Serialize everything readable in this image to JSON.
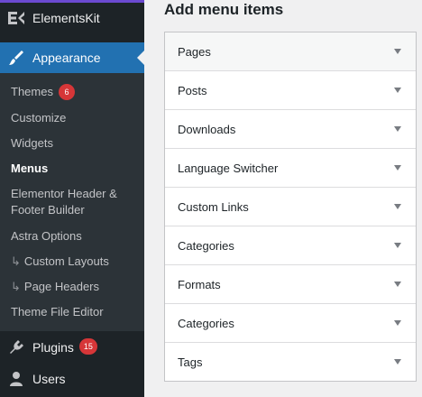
{
  "sidebar": {
    "elementskit": {
      "label": "ElementsKit"
    },
    "appearance": {
      "label": "Appearance"
    },
    "submenu": [
      {
        "label": "Themes",
        "badge": "6"
      },
      {
        "label": "Customize"
      },
      {
        "label": "Widgets"
      },
      {
        "label": "Menus"
      },
      {
        "label_line1": "Elementor Header &",
        "label_line2": "Footer Builder"
      },
      {
        "label": "Astra Options"
      },
      {
        "label": "Custom Layouts",
        "prefix": "↳"
      },
      {
        "label": "Page Headers",
        "prefix": "↳"
      },
      {
        "label": "Theme File Editor"
      }
    ],
    "plugins": {
      "label": "Plugins",
      "badge": "15"
    },
    "users": {
      "label": "Users"
    }
  },
  "main": {
    "title": "Add menu items",
    "accordion": [
      {
        "label": "Pages"
      },
      {
        "label": "Posts"
      },
      {
        "label": "Downloads"
      },
      {
        "label": "Language Switcher"
      },
      {
        "label": "Custom Links"
      },
      {
        "label": "Categories"
      },
      {
        "label": "Formats"
      },
      {
        "label": "Categories"
      },
      {
        "label": "Tags"
      }
    ]
  },
  "icons": {
    "elementskit": "elementskit-icon",
    "appearance": "paintbrush-icon",
    "plugins": "plug-icon",
    "users": "user-icon",
    "accordion": "caret-down-icon"
  },
  "colors": {
    "sidebar_bg": "#1d2327",
    "submenu_bg": "#2c3338",
    "accent": "#2271b1",
    "badge": "#d63638"
  }
}
